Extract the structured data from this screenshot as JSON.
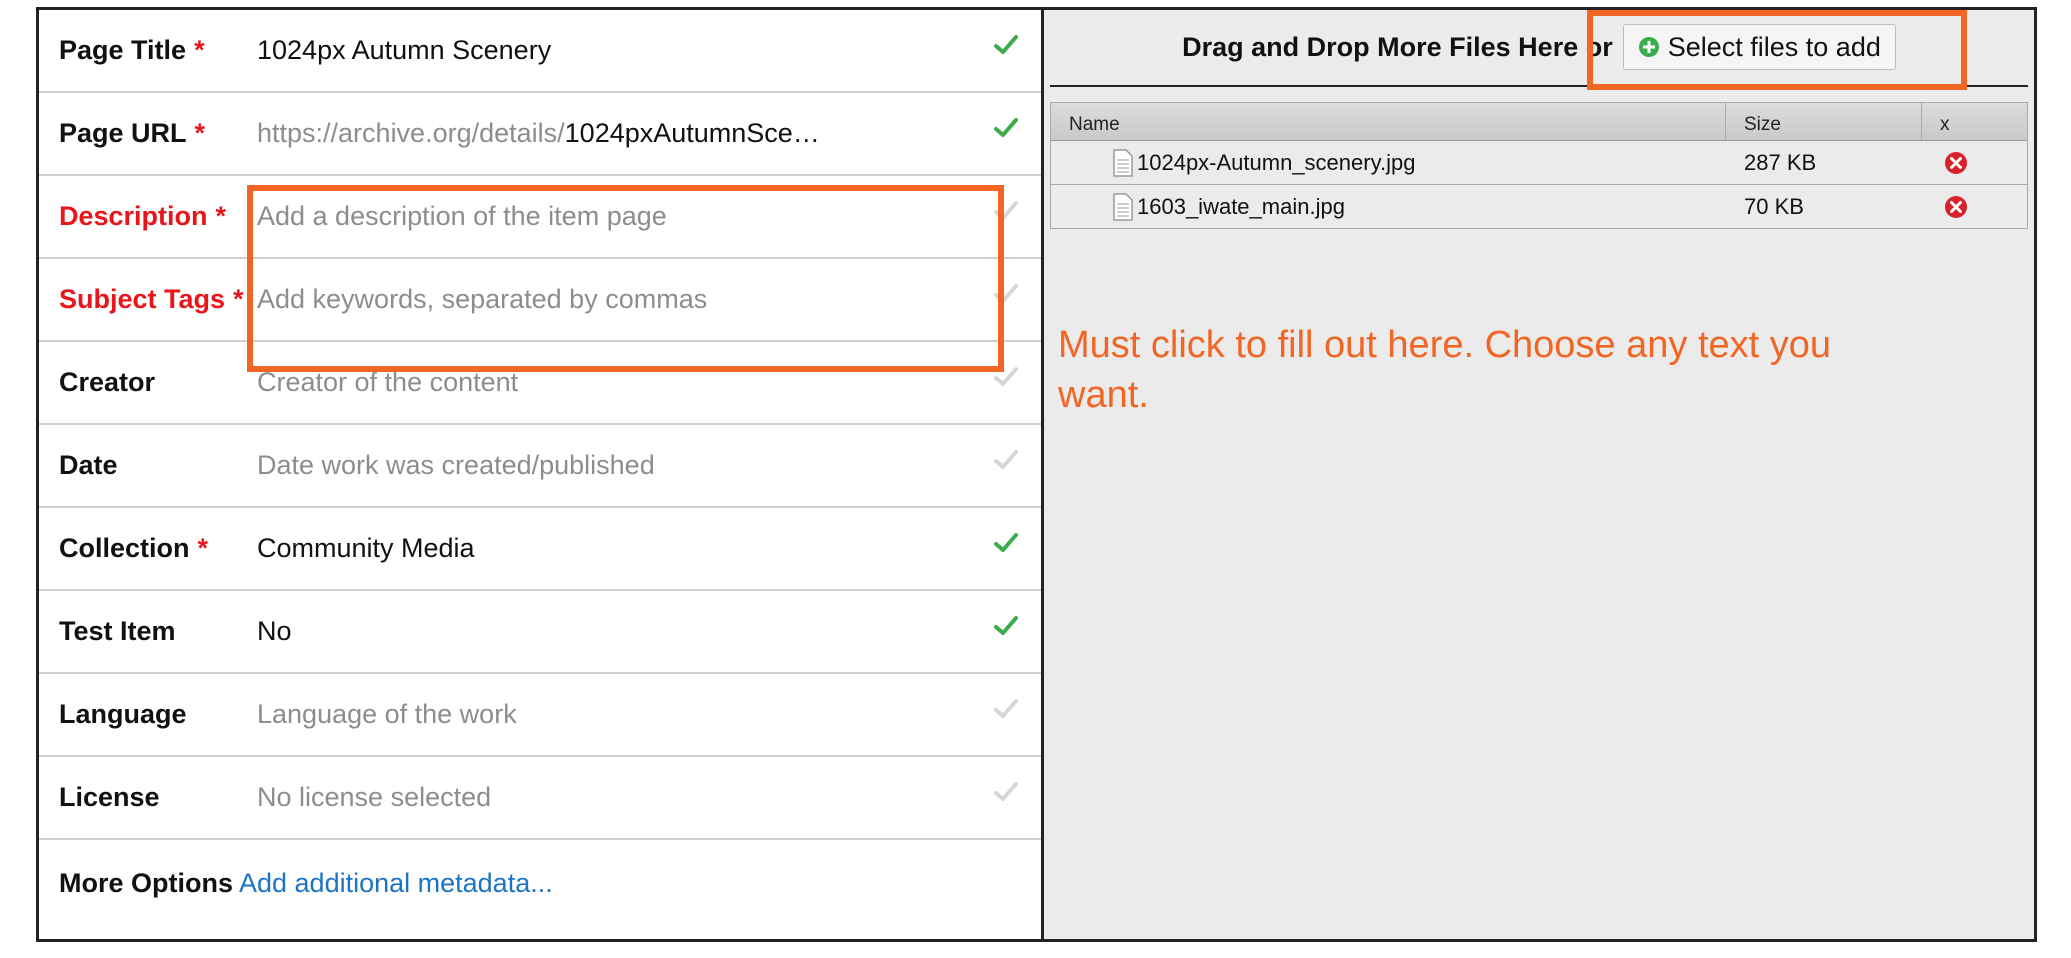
{
  "form": {
    "fields": [
      {
        "label": "Page Title",
        "required": true,
        "value": "1024px Autumn Scenery",
        "placeholder": false,
        "valid": true
      },
      {
        "label": "Page URL",
        "required": true,
        "url_prefix": "https://archive.org/details/",
        "value": "1024pxAutumnSce…",
        "placeholder": false,
        "valid": true
      },
      {
        "label": "Description",
        "required": true,
        "missing": true,
        "value": "Add a description of the item page",
        "placeholder": true,
        "valid": false
      },
      {
        "label": "Subject Tags",
        "required": true,
        "missing": true,
        "value": "Add keywords, separated by commas",
        "placeholder": true,
        "valid": false
      },
      {
        "label": "Creator",
        "required": false,
        "value": "Creator of the content",
        "placeholder": true,
        "valid": false
      },
      {
        "label": "Date",
        "required": false,
        "value": "Date work was created/published",
        "placeholder": true,
        "valid": false
      },
      {
        "label": "Collection",
        "required": true,
        "value": "Community Media",
        "placeholder": false,
        "valid": true
      },
      {
        "label": "Test Item",
        "required": false,
        "value": "No",
        "placeholder": false,
        "valid": true
      },
      {
        "label": "Language",
        "required": false,
        "value": "Language of the work",
        "placeholder": true,
        "valid": false
      },
      {
        "label": "License",
        "required": false,
        "value": "No license selected",
        "placeholder": true,
        "valid": false
      },
      {
        "label": "More Options",
        "required": false,
        "value": "Add additional metadata...",
        "link": true
      }
    ],
    "required_mark": "*"
  },
  "upload": {
    "drop_text": "Drag and Drop More Files Here or",
    "select_button": "Select files to add",
    "columns": [
      "Name",
      "Size",
      "x"
    ],
    "files": [
      {
        "name": "1024px-Autumn_scenery.jpg",
        "size": "287 KB"
      },
      {
        "name": "1603_iwate_main.jpg",
        "size": "70 KB"
      }
    ]
  },
  "annotation": {
    "text": "Must click to fill out here. Choose any text you want."
  },
  "colors": {
    "valid_check": "#3cab4b",
    "inactive_check": "#d6d6d6",
    "required": "#e8161b",
    "annotation": "#f26522",
    "link": "#1b74c4",
    "remove": "#d8222a"
  },
  "icons": {
    "check": "check-icon",
    "add": "plus-circle-icon",
    "file": "document-icon",
    "remove": "remove-icon"
  }
}
